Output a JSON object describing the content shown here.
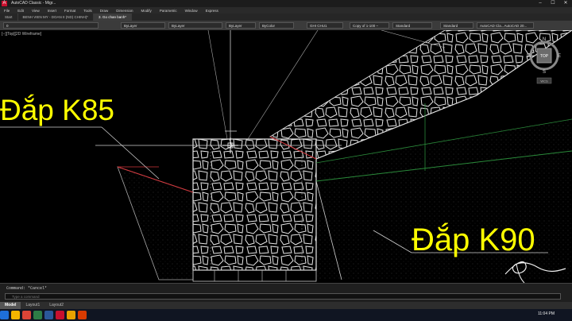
{
  "window": {
    "title": "AutoCAD Classic - Migr...",
    "controls": [
      "–",
      "☐",
      "✕"
    ]
  },
  "menu": [
    "File",
    "Edit",
    "View",
    "Insert",
    "Format",
    "Tools",
    "Draw",
    "Dimension",
    "Modify",
    "Parametric",
    "Window",
    "Express"
  ],
  "tabs": [
    {
      "label": "Start",
      "active": false
    },
    {
      "label": "BENH VIEN MY - DOAN II (ND) CHINH)*",
      "active": false
    },
    {
      "label": "3. Go chan banh*",
      "active": true
    }
  ],
  "toolbar": {
    "layer_value": "0",
    "color_value": "ByLayer",
    "linetype_value": "ByLayer",
    "lineweight_value": "ByLayer",
    "plotstyle_value": "ByColor",
    "textstyle_value": "GHI CHU1",
    "dimstyle_value": "Copy of 1-100 –",
    "tablestyle_value": "Standard",
    "mleader_value": "Standard",
    "workspace_value": "AutoCAD Cla...AutoCAD 20..."
  },
  "viewport_label": "[−][Top][2D Wireframe]",
  "annotations": {
    "left_label": "Đắp K85",
    "right_label": "Đắp K90"
  },
  "viewcube": {
    "north": "N",
    "south": "S",
    "east": "E",
    "west": "W",
    "face": "TOP",
    "wcs": "WCS"
  },
  "command": {
    "history": "Command: *Cancel*",
    "placeholder": "Type a command"
  },
  "layout_tabs": [
    "Model",
    "Layout1",
    "Layout2"
  ],
  "taskbar": {
    "time": "11:04 PM"
  },
  "colors": {
    "annotation": "#ffff00",
    "background": "#000000",
    "red_line": "#d0343a",
    "green_line": "#2a8a3a"
  }
}
